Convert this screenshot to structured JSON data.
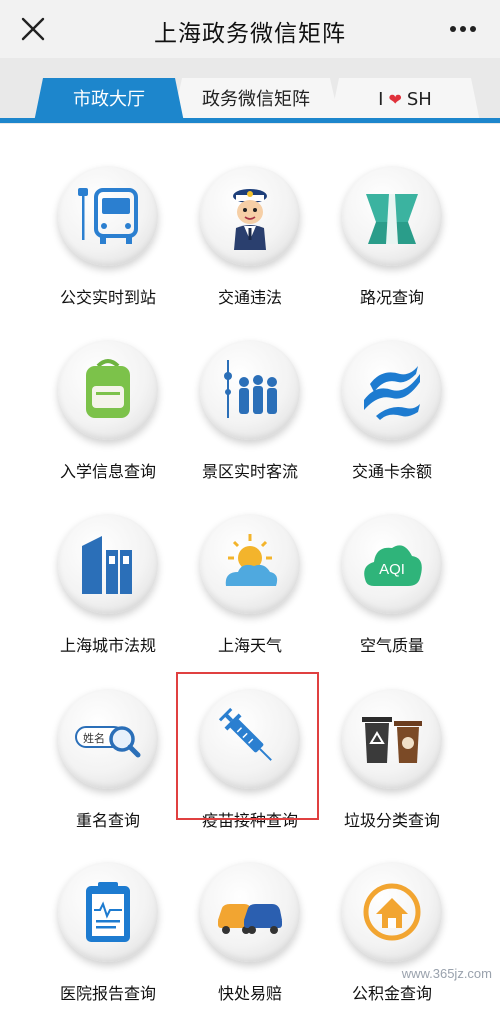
{
  "header": {
    "title": "上海政务微信矩阵",
    "close_icon": "close-icon",
    "more_icon": "more-icon"
  },
  "tabs": [
    {
      "label": "市政大厅",
      "active": true
    },
    {
      "label": "政务微信矩阵",
      "active": false
    },
    {
      "label_pre": "I",
      "label_post": "SH",
      "icon": "heart-icon",
      "active": false
    }
  ],
  "colors": {
    "accent": "#1d86cc",
    "highlight": "#e04040",
    "heart": "#e0313b"
  },
  "services": [
    {
      "label": "公交实时到站",
      "icon": "bus-stop-icon"
    },
    {
      "label": "交通违法",
      "icon": "traffic-police-icon"
    },
    {
      "label": "路况查询",
      "icon": "road-icon"
    },
    {
      "label": "入学信息查询",
      "icon": "backpack-icon"
    },
    {
      "label": "景区实时客流",
      "icon": "crowd-icon"
    },
    {
      "label": "交通卡余额",
      "icon": "transit-card-icon"
    },
    {
      "label": "上海城市法规",
      "icon": "law-books-icon"
    },
    {
      "label": "上海天气",
      "icon": "weather-icon"
    },
    {
      "label": "空气质量",
      "icon": "aqi-cloud-icon",
      "icon_text": "AQI"
    },
    {
      "label": "重名查询",
      "icon": "name-search-icon",
      "icon_text": "姓名"
    },
    {
      "label": "疫苗接种查询",
      "icon": "vaccine-syringe-icon",
      "highlighted": true
    },
    {
      "label": "垃圾分类查询",
      "icon": "trash-bins-icon"
    },
    {
      "label": "医院报告查询",
      "icon": "medical-report-icon"
    },
    {
      "label": "快处易赔",
      "icon": "car-accident-icon"
    },
    {
      "label": "公积金查询",
      "icon": "housing-fund-icon"
    }
  ],
  "watermark": "www.365jz.com"
}
